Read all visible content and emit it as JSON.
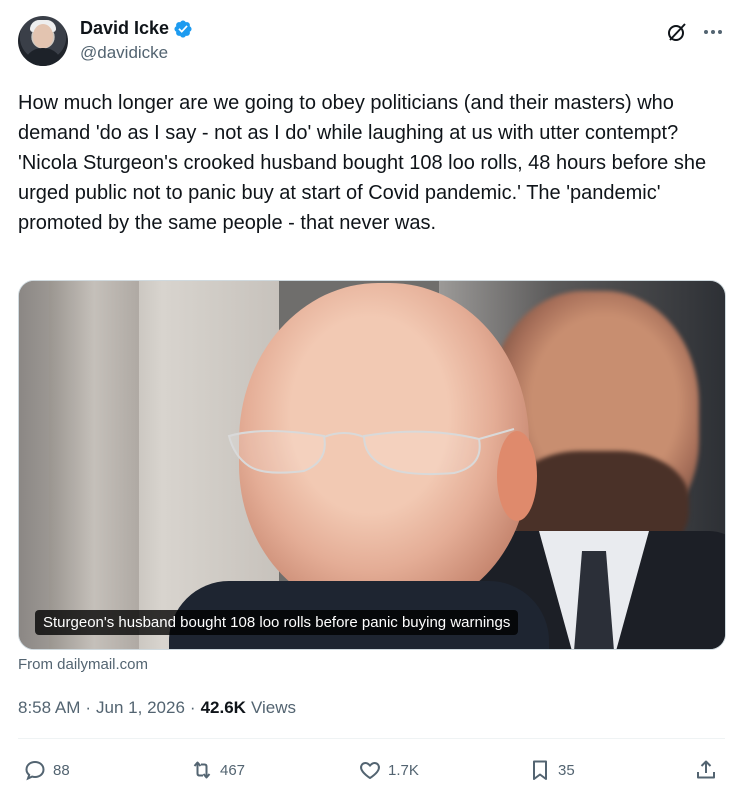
{
  "author": {
    "display_name": "David Icke",
    "handle": "@davidicke",
    "verified": true
  },
  "header_icons": [
    "grok-icon",
    "more-icon"
  ],
  "tweet": {
    "text": "How much longer are we going to obey politicians (and their masters) who demand 'do as I say - not as I do' while laughing at us with utter contempt? 'Nicola Sturgeon's crooked husband bought 108 loo rolls, 48 hours before she urged public not to panic buy at start of Covid pandemic.' The 'pandemic' promoted by the same people - that never was."
  },
  "card": {
    "caption": "Sturgeon's husband bought 108 loo rolls before panic buying warnings",
    "source": "From dailymail.com"
  },
  "meta": {
    "time": "8:58 AM",
    "date": "Jun 1, 2026",
    "views_count": "42.6K",
    "views_label": "Views",
    "separator": "·"
  },
  "actions": {
    "replies": "88",
    "reposts": "467",
    "likes": "1.7K",
    "bookmarks": "35"
  },
  "colors": {
    "verified_blue": "#1d9bf0",
    "text_primary": "#0f1419",
    "text_secondary": "#536471"
  }
}
